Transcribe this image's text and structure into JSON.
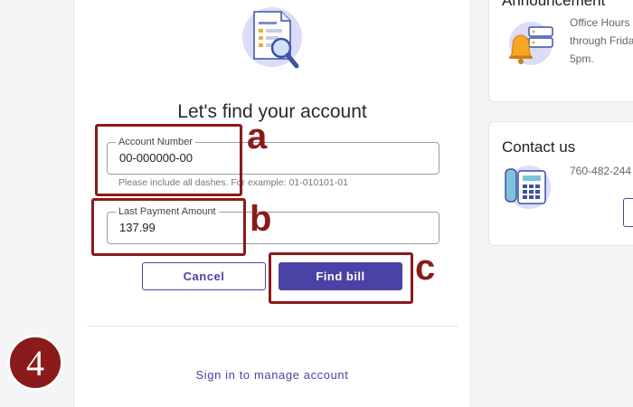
{
  "main": {
    "title": "Let's find your account",
    "account_number": {
      "label": "Account Number",
      "value": "00-000000-00",
      "hint": "Please include all dashes. For example: 01-010101-01"
    },
    "last_payment": {
      "label": "Last Payment Amount",
      "value": "137.99"
    },
    "cancel_label": "Cancel",
    "find_label": "Find bill",
    "signin_label": "Sign in to manage account"
  },
  "announcement": {
    "title": "Announcement",
    "lines": [
      "Office Hours",
      "through Frida",
      "5pm."
    ]
  },
  "contact": {
    "title": "Contact us",
    "phone": "760-482-244"
  },
  "annotations": {
    "a": "a",
    "b": "b",
    "c": "c",
    "step": "4"
  },
  "colors": {
    "brand": "#4a43a5",
    "annotation": "#8b1a1a",
    "icon_bg": "#dcdcf8",
    "bell": "#f5a623"
  }
}
